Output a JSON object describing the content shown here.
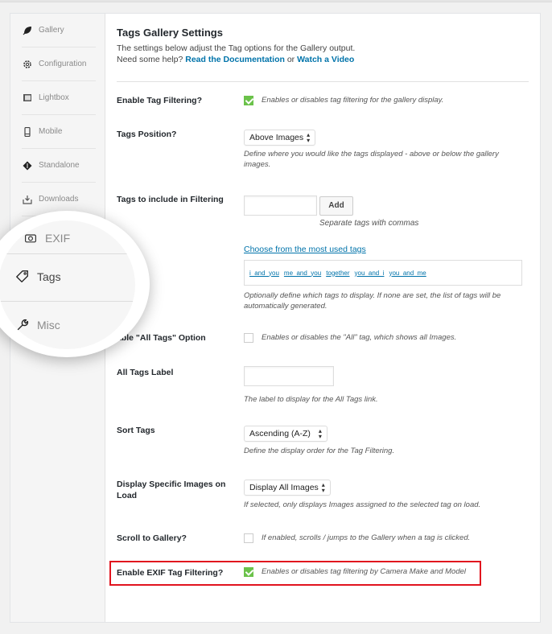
{
  "sidebar": {
    "items": [
      {
        "label": "Gallery",
        "icon": "leaf-icon"
      },
      {
        "label": "Configuration",
        "icon": "gear-icon"
      },
      {
        "label": "Lightbox",
        "icon": "lightbox-icon"
      },
      {
        "label": "Mobile",
        "icon": "mobile-icon"
      },
      {
        "label": "Standalone",
        "icon": "standalone-icon"
      },
      {
        "label": "Downloads",
        "icon": "download-icon"
      }
    ],
    "magnified": [
      {
        "label": "EXIF",
        "icon": "camera-icon"
      },
      {
        "label": "Tags",
        "icon": "tag-icon",
        "active": true
      },
      {
        "label": "Misc",
        "icon": "wrench-icon"
      }
    ]
  },
  "header": {
    "title": "Tags Gallery Settings",
    "intro": "The settings below adjust the Tag options for the Gallery output.",
    "help_prefix": "Need some help?",
    "doc_link": "Read the Documentation",
    "or": "or",
    "video_link": "Watch a Video"
  },
  "settings": {
    "enable_tag_filtering": {
      "label": "Enable Tag Filtering?",
      "checked": true,
      "desc": "Enables or disables tag filtering for the gallery display."
    },
    "tags_position": {
      "label": "Tags Position?",
      "value": "Above Images",
      "desc": "Define where you would like the tags displayed - above or below the gallery images."
    },
    "tags_include": {
      "label": "Tags to include in Filtering",
      "input_value": "",
      "add_label": "Add",
      "hint": "Separate tags with commas",
      "choose_link": "Choose from the most used tags",
      "tags": [
        "i_and_you",
        "me_and_you",
        "together",
        "you_and_i",
        "you_and_me"
      ],
      "desc": "Optionally define which tags to display. If none are set, the list of tags will be automatically generated."
    },
    "all_tags_option": {
      "label": "Enable \"All Tags\" Option",
      "label_visible": "able \"All Tags\" Option",
      "checked": false,
      "desc": "Enables or disables the \"All\" tag, which shows all Images."
    },
    "all_tags_label": {
      "label": "All Tags Label",
      "value": "",
      "desc": "The label to display for the All Tags link."
    },
    "sort_tags": {
      "label": "Sort Tags",
      "value": "Ascending (A-Z)",
      "desc": "Define the display order for the Tag Filtering."
    },
    "display_specific": {
      "label": "Display Specific Images on Load",
      "value": "Display All Images",
      "desc": "If selected, only displays Images assigned to the selected tag on load."
    },
    "scroll_to_gallery": {
      "label": "Scroll to Gallery?",
      "checked": false,
      "desc": "If enabled, scrolls / jumps to the Gallery when a tag is clicked."
    },
    "exif_tag_filtering": {
      "label": "Enable EXIF Tag Filtering?",
      "checked": true,
      "desc": "Enables or disables tag filtering by Camera Make and Model"
    }
  },
  "colors": {
    "accent_link": "#0073aa",
    "checkbox_checked": "#6bc24a",
    "highlight_border": "#e1141e"
  }
}
